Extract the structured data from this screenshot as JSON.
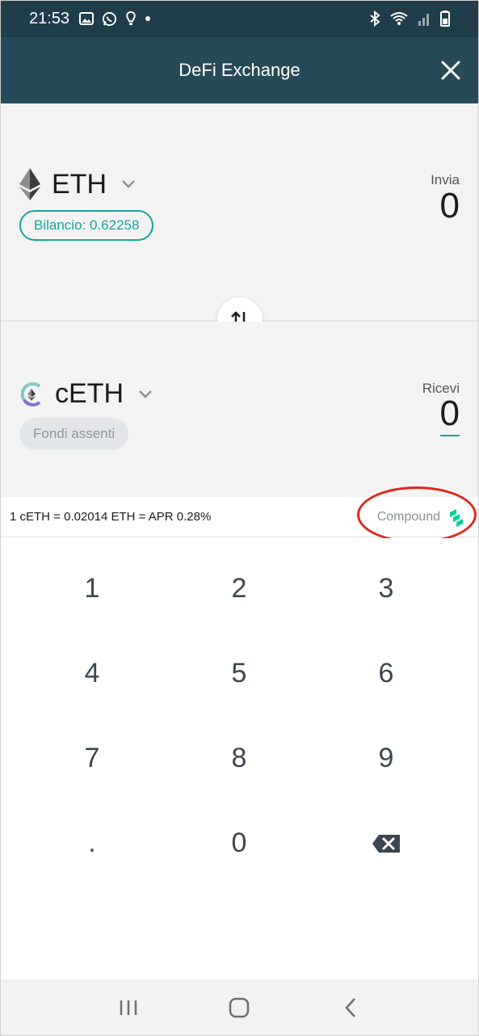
{
  "status_bar": {
    "time": "21:53",
    "left_icons": [
      "image-icon",
      "whatsapp-icon",
      "tip-icon",
      "dot-icon"
    ],
    "right_icons": [
      "bluetooth-icon",
      "wifi-icon",
      "signal-icon",
      "battery-icon"
    ]
  },
  "app_bar": {
    "title": "DeFi Exchange",
    "close_icon": "close-icon"
  },
  "send": {
    "token": "ETH",
    "token_icon": "ethereum-icon",
    "balance": "Bilancio: 0.62258",
    "label": "Invia",
    "amount": "0"
  },
  "receive": {
    "token": "cETH",
    "token_icon": "ceth-icon",
    "funds_status": "Fondi assenti",
    "label": "Ricevi",
    "amount": "0"
  },
  "rate": {
    "text": "1 cETH = 0.02014 ETH = APR 0.28%",
    "provider": "Compound",
    "provider_icon": "compound-icon"
  },
  "keypad": {
    "keys": [
      "1",
      "2",
      "3",
      "4",
      "5",
      "6",
      "7",
      "8",
      "9",
      ".",
      "0",
      "backspace"
    ]
  },
  "nav_bar": {
    "icons": [
      "recent-apps-icon",
      "home-icon",
      "back-icon"
    ]
  },
  "colors": {
    "status_bar": "#1f3d4b",
    "app_bar": "#284a58",
    "accent": "#17a69a",
    "annotation": "#e0281c"
  }
}
